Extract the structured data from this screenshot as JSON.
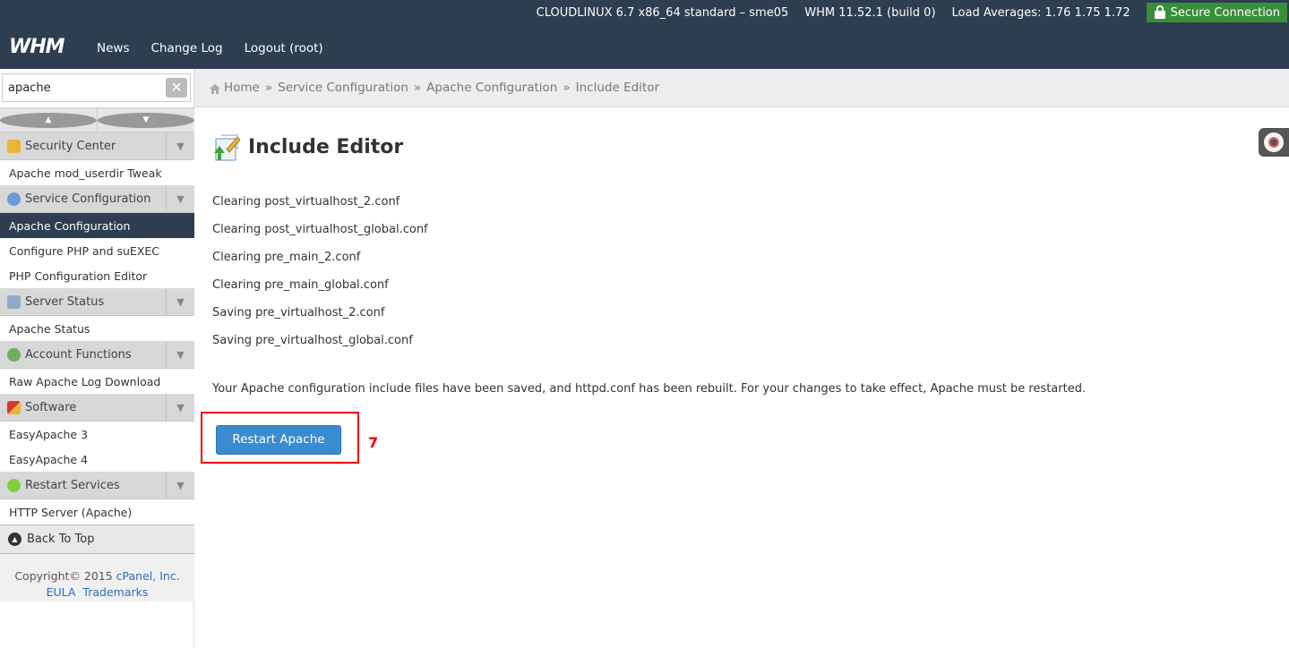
{
  "header": {
    "logo": "WHM",
    "os": "CLOUDLINUX 6.7 x86_64 standard – sme05",
    "version": "WHM 11.52.1 (build 0)",
    "load": "Load Averages: 1.76 1.75 1.72",
    "secure": "Secure Connection",
    "nav": [
      "News",
      "Change Log",
      "Logout (root)"
    ]
  },
  "search": {
    "value": "apache"
  },
  "sidebar": {
    "groups": [
      {
        "category": "Security Center",
        "items": [
          "Apache mod_userdir Tweak"
        ]
      },
      {
        "category": "Service Configuration",
        "items": [
          "Apache Configuration",
          "Configure PHP and suEXEC",
          "PHP Configuration Editor"
        ]
      },
      {
        "category": "Server Status",
        "items": [
          "Apache Status"
        ]
      },
      {
        "category": "Account Functions",
        "items": [
          "Raw Apache Log Download"
        ]
      },
      {
        "category": "Software",
        "items": [
          "EasyApache 3",
          "EasyApache 4"
        ]
      },
      {
        "category": "Restart Services",
        "items": [
          "HTTP Server (Apache)"
        ]
      }
    ],
    "back_to_top": "Back To Top",
    "copyright": "Copyright© 2015",
    "company": "cPanel, Inc.",
    "eula": "EULA",
    "trademarks": "Trademarks"
  },
  "breadcrumb": [
    "Home",
    "Service Configuration",
    "Apache Configuration",
    "Include Editor"
  ],
  "main": {
    "title": "Include Editor",
    "log": [
      "Clearing post_virtualhost_2.conf",
      "Clearing post_virtualhost_global.conf",
      "Clearing pre_main_2.conf",
      "Clearing pre_main_global.conf",
      "Saving pre_virtualhost_2.conf",
      "Saving pre_virtualhost_global.conf"
    ],
    "message": "Your Apache configuration include files have been saved, and httpd.conf has been rebuilt. For your changes to take effect, Apache must be restarted.",
    "restart_label": "Restart Apache",
    "step_number": "7"
  },
  "colors": {
    "header_bg": "#2c3e50",
    "button": "#3b8bd0",
    "secure": "#3a8d3a",
    "highlight": "#ee0000"
  }
}
